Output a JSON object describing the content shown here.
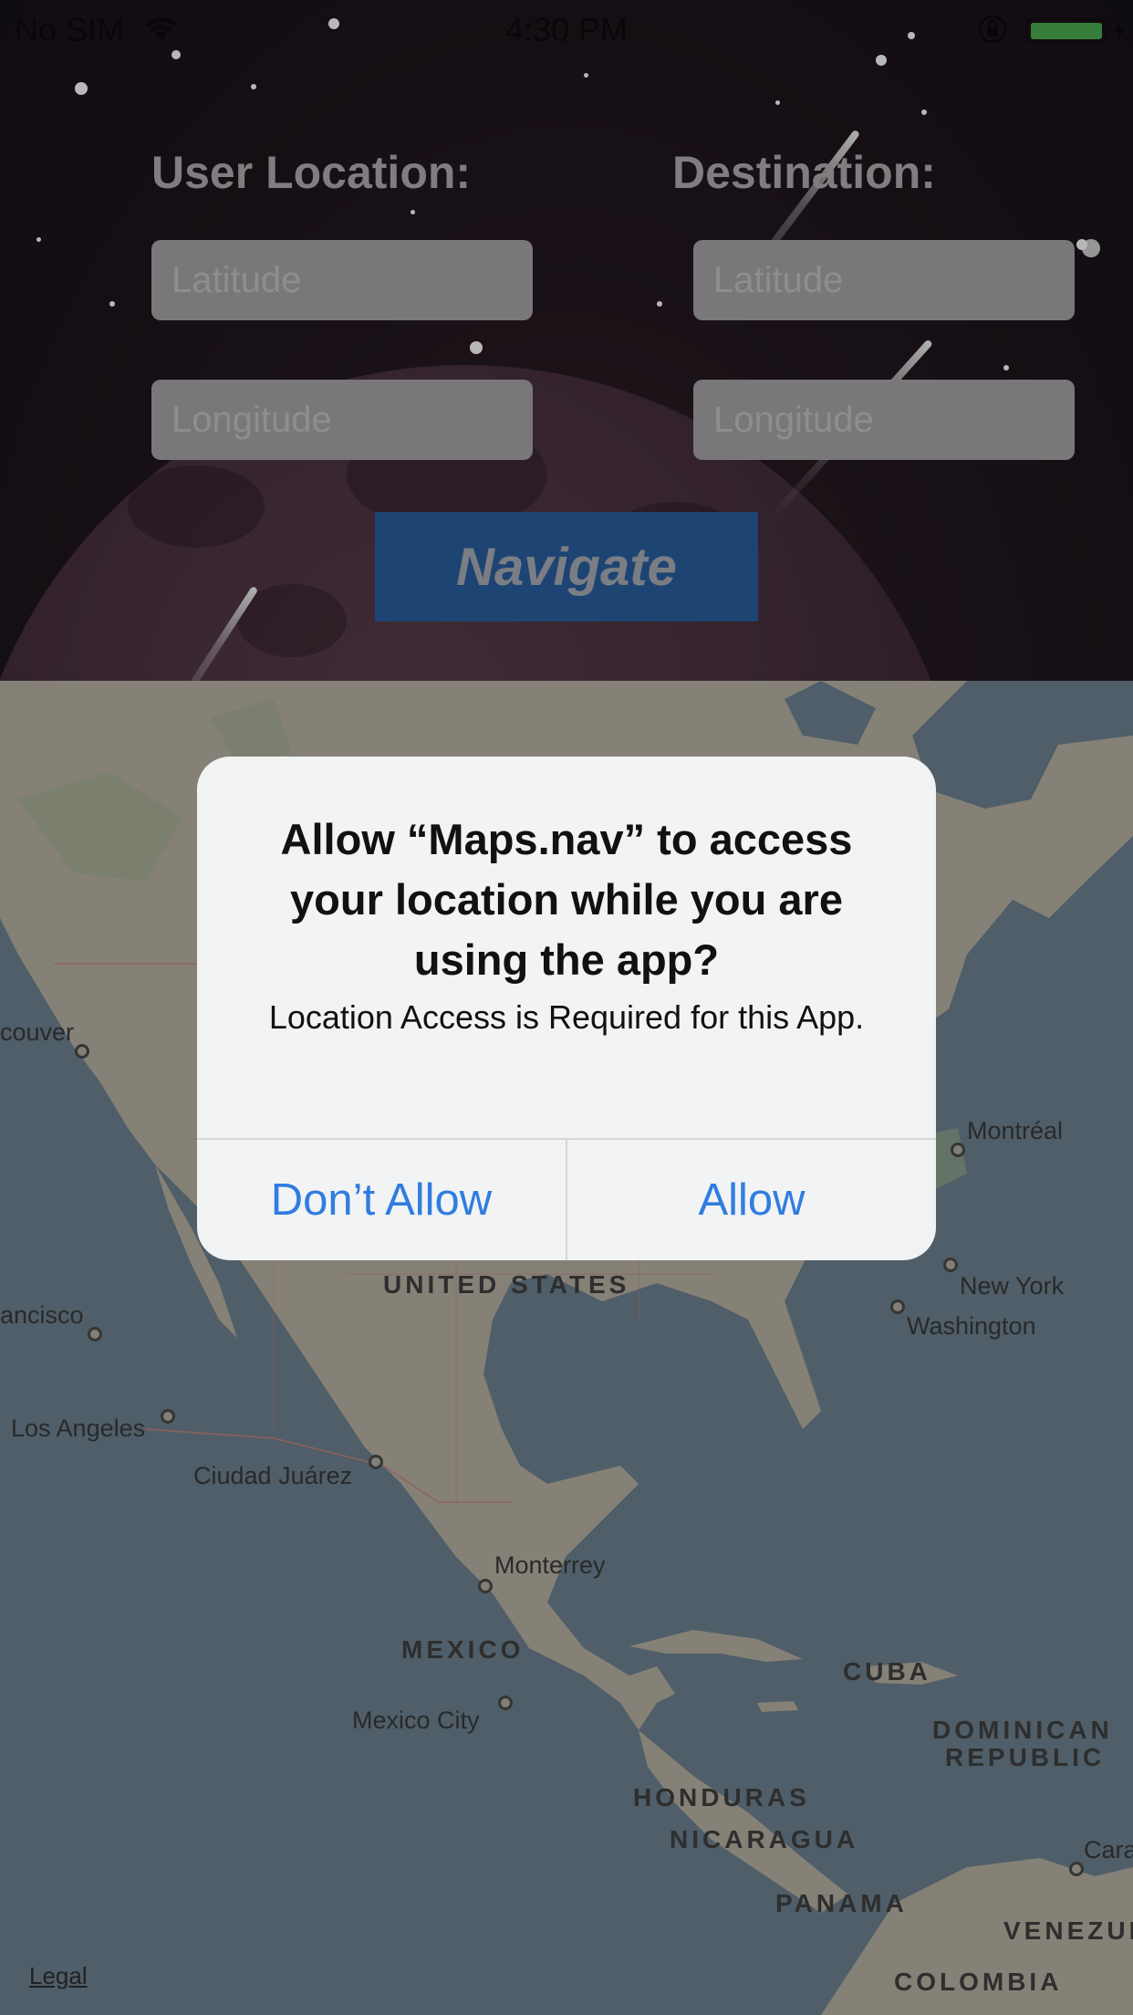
{
  "status_bar": {
    "carrier": "No SIM",
    "time": "4:30 PM",
    "battery_color": "#4caf50"
  },
  "form": {
    "user_location_heading": "User Location:",
    "destination_heading": "Destination:",
    "latitude_placeholder": "Latitude",
    "longitude_placeholder": "Longitude",
    "navigate_label": "Navigate",
    "navigate_color": "#2a5fa0"
  },
  "map": {
    "labels": {
      "vancouver": "couver",
      "san_francisco": "ancisco",
      "los_angeles": "Los Angeles",
      "ciudad_juarez": "Ciudad Juárez",
      "monterrey": "Monterrey",
      "mexico_city": "Mexico City",
      "montreal": "Montréal",
      "new_york": "New York",
      "washington": "Washington",
      "caracas": "Cara",
      "united_states": "UNITED STATES",
      "mexico": "MEXICO",
      "cuba": "CUBA",
      "dominican_republic_1": "DOMINICAN",
      "dominican_republic_2": "REPUBLIC",
      "honduras": "HONDURAS",
      "nicaragua": "NICARAGUA",
      "panama": "PANAMA",
      "venezuela": "VENEZUE",
      "colombia": "COLOMBIA"
    },
    "legal": "Legal"
  },
  "alert": {
    "title": "Allow “Maps.nav” to access your location while you are using the app?",
    "message": "Location Access is Required for this App.",
    "dont_allow_label": "Don’t Allow",
    "allow_label": "Allow",
    "button_color": "#2f7de0"
  }
}
